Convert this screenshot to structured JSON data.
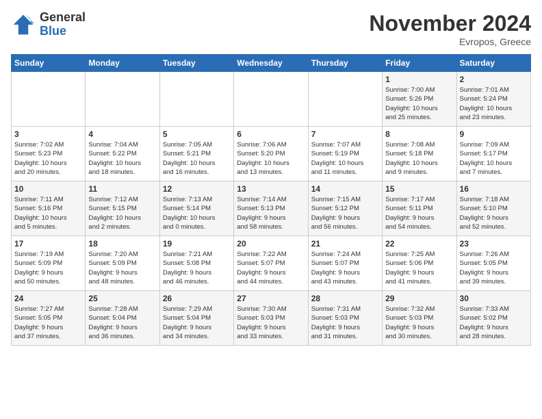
{
  "logo": {
    "general": "General",
    "blue": "Blue"
  },
  "title": "November 2024",
  "location": "Evropos, Greece",
  "days_of_week": [
    "Sunday",
    "Monday",
    "Tuesday",
    "Wednesday",
    "Thursday",
    "Friday",
    "Saturday"
  ],
  "weeks": [
    [
      {
        "day": "",
        "info": ""
      },
      {
        "day": "",
        "info": ""
      },
      {
        "day": "",
        "info": ""
      },
      {
        "day": "",
        "info": ""
      },
      {
        "day": "",
        "info": ""
      },
      {
        "day": "1",
        "info": "Sunrise: 7:00 AM\nSunset: 5:26 PM\nDaylight: 10 hours\nand 25 minutes."
      },
      {
        "day": "2",
        "info": "Sunrise: 7:01 AM\nSunset: 5:24 PM\nDaylight: 10 hours\nand 23 minutes."
      }
    ],
    [
      {
        "day": "3",
        "info": "Sunrise: 7:02 AM\nSunset: 5:23 PM\nDaylight: 10 hours\nand 20 minutes."
      },
      {
        "day": "4",
        "info": "Sunrise: 7:04 AM\nSunset: 5:22 PM\nDaylight: 10 hours\nand 18 minutes."
      },
      {
        "day": "5",
        "info": "Sunrise: 7:05 AM\nSunset: 5:21 PM\nDaylight: 10 hours\nand 16 minutes."
      },
      {
        "day": "6",
        "info": "Sunrise: 7:06 AM\nSunset: 5:20 PM\nDaylight: 10 hours\nand 13 minutes."
      },
      {
        "day": "7",
        "info": "Sunrise: 7:07 AM\nSunset: 5:19 PM\nDaylight: 10 hours\nand 11 minutes."
      },
      {
        "day": "8",
        "info": "Sunrise: 7:08 AM\nSunset: 5:18 PM\nDaylight: 10 hours\nand 9 minutes."
      },
      {
        "day": "9",
        "info": "Sunrise: 7:09 AM\nSunset: 5:17 PM\nDaylight: 10 hours\nand 7 minutes."
      }
    ],
    [
      {
        "day": "10",
        "info": "Sunrise: 7:11 AM\nSunset: 5:16 PM\nDaylight: 10 hours\nand 5 minutes."
      },
      {
        "day": "11",
        "info": "Sunrise: 7:12 AM\nSunset: 5:15 PM\nDaylight: 10 hours\nand 2 minutes."
      },
      {
        "day": "12",
        "info": "Sunrise: 7:13 AM\nSunset: 5:14 PM\nDaylight: 10 hours\nand 0 minutes."
      },
      {
        "day": "13",
        "info": "Sunrise: 7:14 AM\nSunset: 5:13 PM\nDaylight: 9 hours\nand 58 minutes."
      },
      {
        "day": "14",
        "info": "Sunrise: 7:15 AM\nSunset: 5:12 PM\nDaylight: 9 hours\nand 56 minutes."
      },
      {
        "day": "15",
        "info": "Sunrise: 7:17 AM\nSunset: 5:11 PM\nDaylight: 9 hours\nand 54 minutes."
      },
      {
        "day": "16",
        "info": "Sunrise: 7:18 AM\nSunset: 5:10 PM\nDaylight: 9 hours\nand 52 minutes."
      }
    ],
    [
      {
        "day": "17",
        "info": "Sunrise: 7:19 AM\nSunset: 5:09 PM\nDaylight: 9 hours\nand 50 minutes."
      },
      {
        "day": "18",
        "info": "Sunrise: 7:20 AM\nSunset: 5:09 PM\nDaylight: 9 hours\nand 48 minutes."
      },
      {
        "day": "19",
        "info": "Sunrise: 7:21 AM\nSunset: 5:08 PM\nDaylight: 9 hours\nand 46 minutes."
      },
      {
        "day": "20",
        "info": "Sunrise: 7:22 AM\nSunset: 5:07 PM\nDaylight: 9 hours\nand 44 minutes."
      },
      {
        "day": "21",
        "info": "Sunrise: 7:24 AM\nSunset: 5:07 PM\nDaylight: 9 hours\nand 43 minutes."
      },
      {
        "day": "22",
        "info": "Sunrise: 7:25 AM\nSunset: 5:06 PM\nDaylight: 9 hours\nand 41 minutes."
      },
      {
        "day": "23",
        "info": "Sunrise: 7:26 AM\nSunset: 5:05 PM\nDaylight: 9 hours\nand 39 minutes."
      }
    ],
    [
      {
        "day": "24",
        "info": "Sunrise: 7:27 AM\nSunset: 5:05 PM\nDaylight: 9 hours\nand 37 minutes."
      },
      {
        "day": "25",
        "info": "Sunrise: 7:28 AM\nSunset: 5:04 PM\nDaylight: 9 hours\nand 36 minutes."
      },
      {
        "day": "26",
        "info": "Sunrise: 7:29 AM\nSunset: 5:04 PM\nDaylight: 9 hours\nand 34 minutes."
      },
      {
        "day": "27",
        "info": "Sunrise: 7:30 AM\nSunset: 5:03 PM\nDaylight: 9 hours\nand 33 minutes."
      },
      {
        "day": "28",
        "info": "Sunrise: 7:31 AM\nSunset: 5:03 PM\nDaylight: 9 hours\nand 31 minutes."
      },
      {
        "day": "29",
        "info": "Sunrise: 7:32 AM\nSunset: 5:03 PM\nDaylight: 9 hours\nand 30 minutes."
      },
      {
        "day": "30",
        "info": "Sunrise: 7:33 AM\nSunset: 5:02 PM\nDaylight: 9 hours\nand 28 minutes."
      }
    ]
  ]
}
